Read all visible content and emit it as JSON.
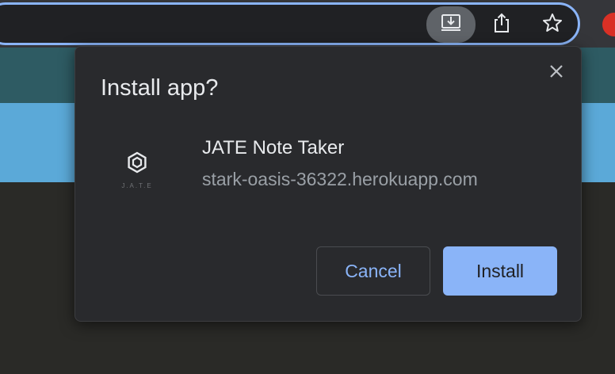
{
  "browser": {
    "toolbar_icons": [
      "install-app-icon",
      "share-icon",
      "bookmark-star-icon"
    ],
    "extension_icon": "extension-icon"
  },
  "dialog": {
    "title": "Install app?",
    "close_icon": "close-icon",
    "app": {
      "icon": "jate-logo-icon",
      "icon_caption": "J.A.T.E",
      "name": "JATE Note Taker",
      "url": "stark-oasis-36322.herokuapp.com"
    },
    "buttons": {
      "cancel": "Cancel",
      "install": "Install"
    }
  },
  "colors": {
    "accent": "#8ab4f8",
    "dialog_bg": "#292a2d",
    "page_teal": "#2e5b63",
    "page_blue": "#5ba9d8"
  }
}
